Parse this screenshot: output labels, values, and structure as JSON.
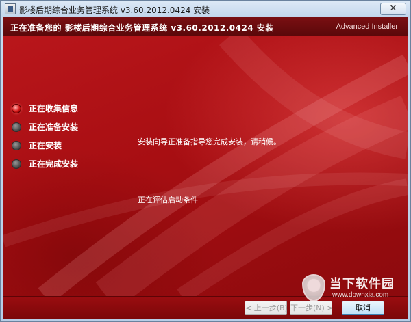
{
  "window": {
    "title": "影楼后期综合业务管理系统  v3.60.2012.0424 安装",
    "close_glyph": "✕"
  },
  "header": {
    "title": "正在准备您的 影楼后期综合业务管理系统  v3.60.2012.0424 安装",
    "brand": "Advanced Installer"
  },
  "steps": [
    {
      "label": "正在收集信息",
      "active": true
    },
    {
      "label": "正在准备安装",
      "active": false
    },
    {
      "label": "正在安装",
      "active": false
    },
    {
      "label": "正在完成安装",
      "active": false
    }
  ],
  "main": {
    "message": "安装向导正准备指导您完成安装，请稍候。",
    "status": "正在评估启动条件"
  },
  "buttons": {
    "back": "< 上一步(B)",
    "next": "下一步(N) >",
    "cancel": "取消"
  },
  "watermark": {
    "name": "当下软件园",
    "url": "www.downxia.com"
  },
  "colors": {
    "header_bg": "#6a0a0d",
    "content_red": "#a70e12",
    "active_step": "#d41616"
  }
}
